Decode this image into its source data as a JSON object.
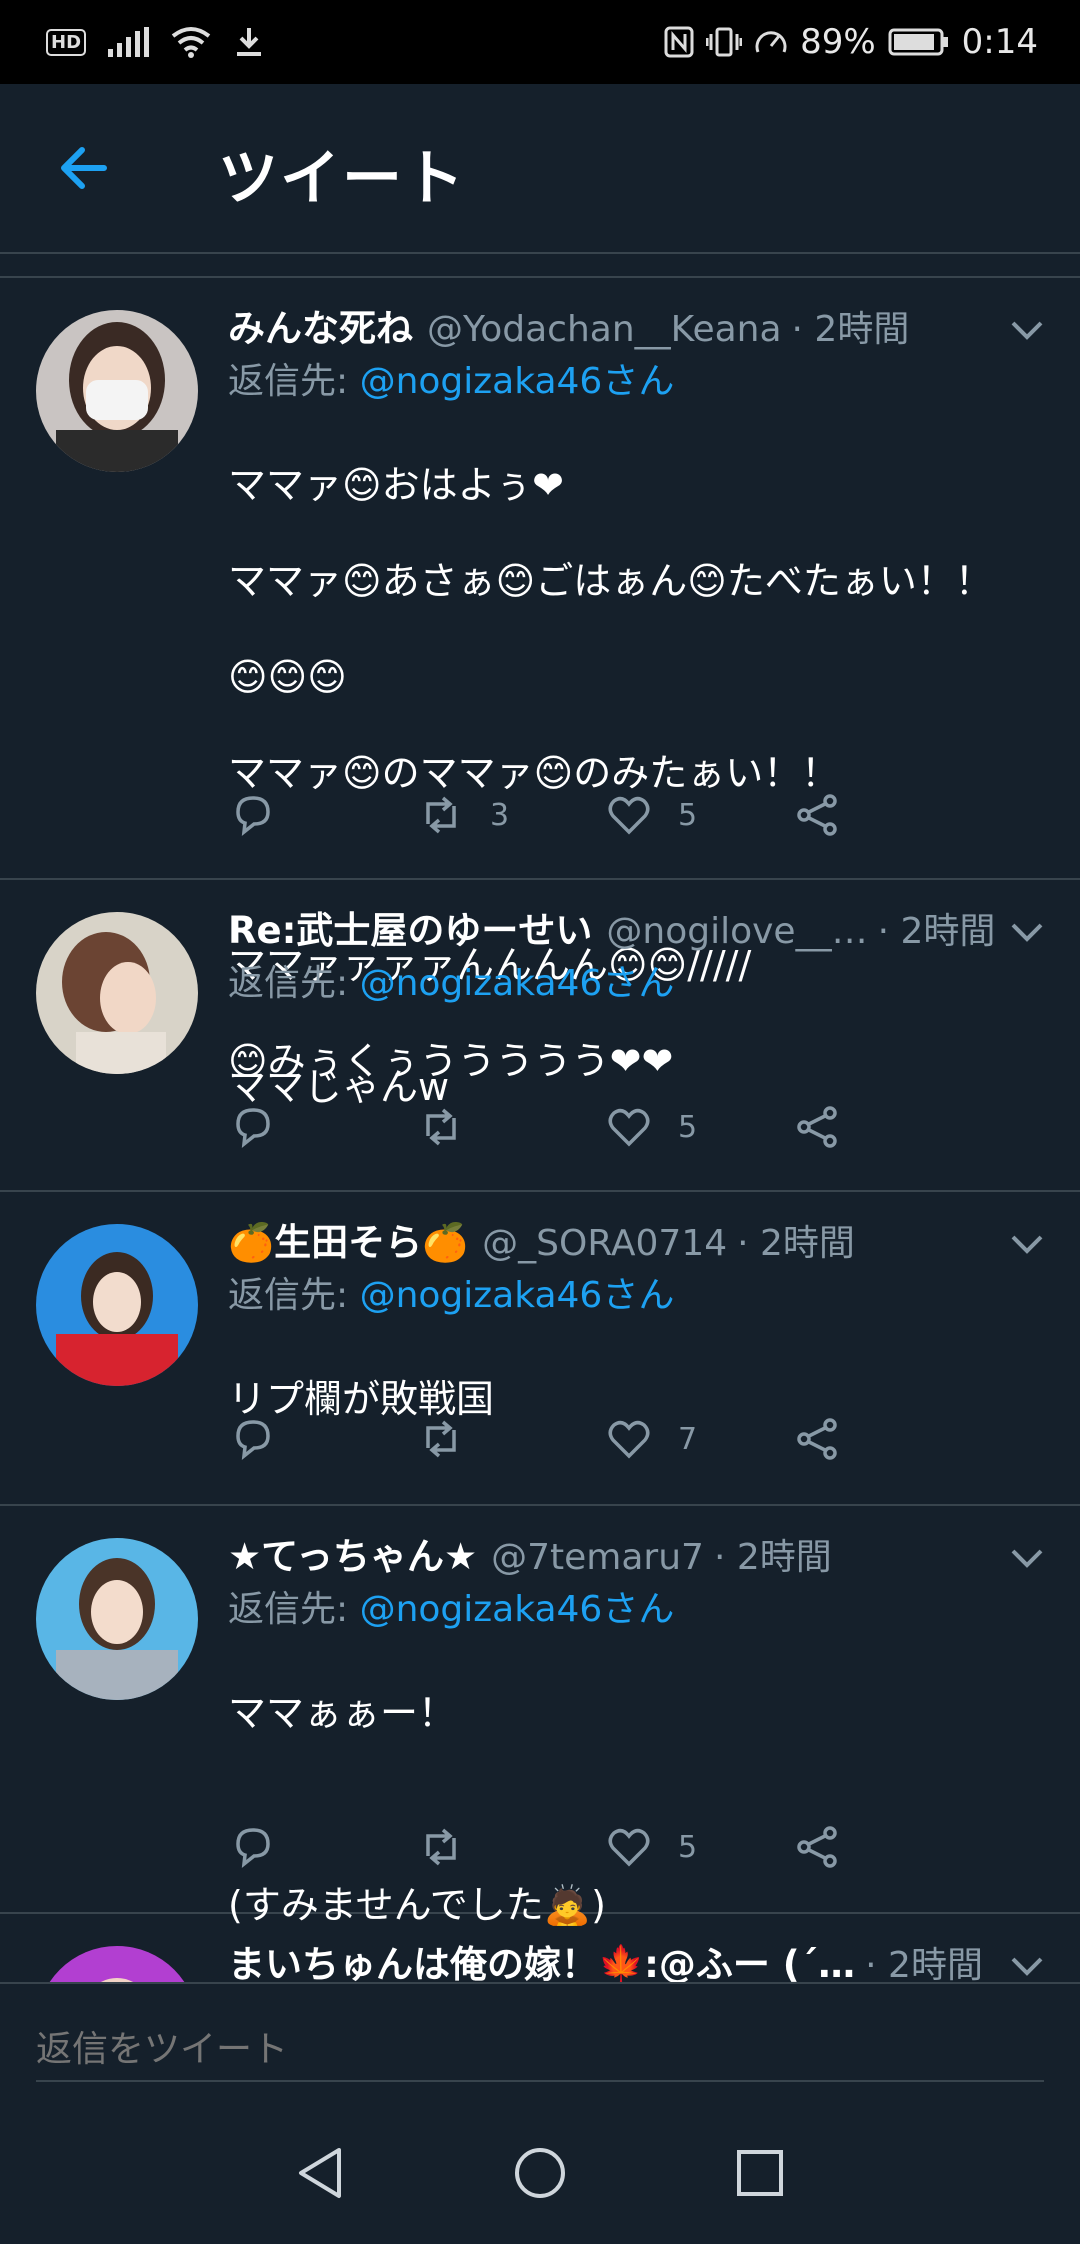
{
  "status": {
    "signal_label": "HD",
    "battery": "89%",
    "time": "0:14"
  },
  "header": {
    "title": "ツイート"
  },
  "tweets": [
    {
      "name": "みんな死ね",
      "handle": "@Yodachan__Keana",
      "time": "· 2時間",
      "reply_prefix": "返信先:",
      "reply_to": "@nogizaka46さん",
      "body_lines": [
        "ママァ😊おはよぅ❤",
        "ママァ😊あさぁ😊ごはぁん😊たべたぁい！！",
        "😊😊😊",
        "ママァ😊のママァ😊のみたぁい！！",
        "",
        "ママァァァァんんんん😊😊/////",
        "😊みぅくぅううううう❤❤"
      ],
      "retweets": "3",
      "likes": "5",
      "avatar_color": "#c9c4c2"
    },
    {
      "name": "Re:武士屋のゆーせい",
      "handle": "@nogilove__…",
      "time": "· 2時間",
      "reply_prefix": "返信先:",
      "reply_to": "@nogizaka46さん",
      "body_lines": [
        "ママじゃんw"
      ],
      "retweets": "",
      "likes": "5",
      "avatar_color": "#b59a8a"
    },
    {
      "name": "🍊生田そら🍊",
      "handle": "@_SORA0714",
      "time": "· 2時間",
      "reply_prefix": "返信先:",
      "reply_to": "@nogizaka46さん",
      "body_lines": [
        "リプ欄が敗戦国"
      ],
      "retweets": "",
      "likes": "7",
      "avatar_color": "#2a8de0"
    },
    {
      "name": "★てっちゃん★",
      "handle": "@7temaru7",
      "time": "· 2時間",
      "reply_prefix": "返信先:",
      "reply_to": "@nogizaka46さん",
      "body_lines": [
        "ママぁぁー！",
        "",
        "(すみませんでした🙇)"
      ],
      "retweets": "",
      "likes": "5",
      "avatar_color": "#59b6e6"
    },
    {
      "name": "まいちゅんは俺の嫁！🍁:@ふー (´…",
      "handle": "",
      "time": "· 2時間",
      "avatar_color": "#b23fd1"
    }
  ],
  "reply_box": {
    "placeholder": "返信をツイート"
  },
  "colors": {
    "background": "#15202b",
    "accent": "#1da1f2",
    "muted": "#8899a6",
    "divider": "#38444d"
  }
}
